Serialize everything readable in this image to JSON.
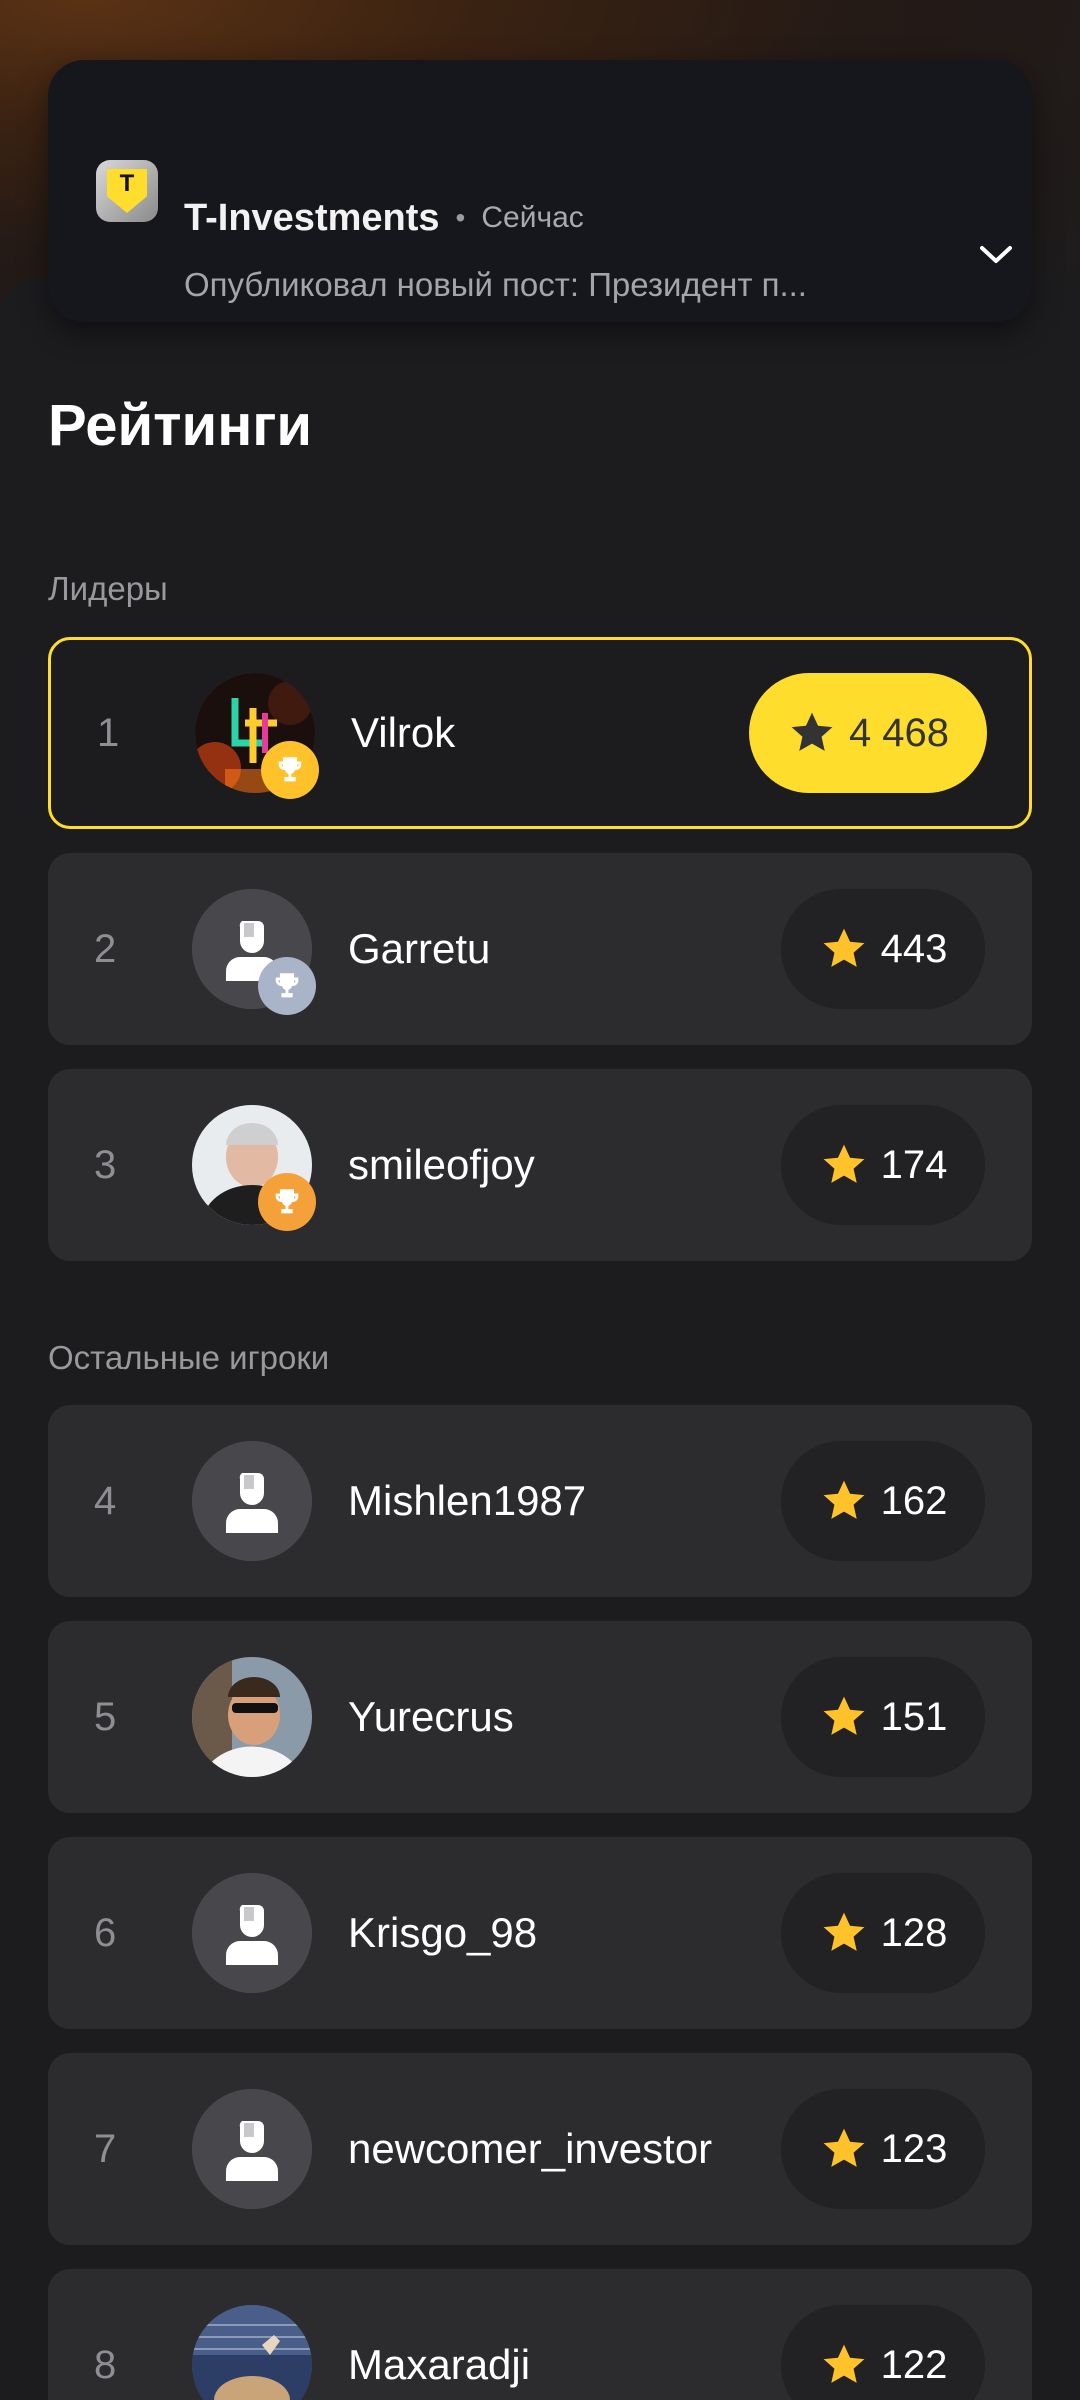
{
  "notification": {
    "app_name": "T-Investments",
    "separator": "•",
    "time": "Сейчас",
    "text": "Опубликовал новый пост: Президент п...",
    "app_icon_letter": "T"
  },
  "page": {
    "title": "Рейтинги"
  },
  "sections": {
    "leaders": "Лидеры",
    "others": "Остальные игроки"
  },
  "players": [
    {
      "rank": "1",
      "name": "Vilrok",
      "score": "4 468",
      "trophy": "gold",
      "avatar": "photo-neon"
    },
    {
      "rank": "2",
      "name": "Garretu",
      "score": "443",
      "trophy": "silver",
      "avatar": "placeholder"
    },
    {
      "rank": "3",
      "name": "smileofjoy",
      "score": "174",
      "trophy": "bronze",
      "avatar": "photo-man"
    },
    {
      "rank": "4",
      "name": "Mishlen1987",
      "score": "162",
      "avatar": "placeholder"
    },
    {
      "rank": "5",
      "name": "Yurecrus",
      "score": "151",
      "avatar": "photo-sunglasses"
    },
    {
      "rank": "6",
      "name": "Krisgo_98",
      "score": "128",
      "avatar": "placeholder"
    },
    {
      "rank": "7",
      "name": "newcomer_investor",
      "score": "123",
      "avatar": "placeholder"
    },
    {
      "rank": "8",
      "name": "Maxaradji",
      "score": "122",
      "avatar": "photo-stadium"
    }
  ],
  "colors": {
    "accent_yellow": "#ffdd2d",
    "star": "#ffc22b",
    "row_bg": "#2c2c2e",
    "page_bg": "#1c1c1e"
  },
  "icons": {
    "star": "star-icon",
    "trophy": "trophy-icon",
    "chevron": "chevron-down-icon",
    "user": "user-placeholder-icon"
  }
}
